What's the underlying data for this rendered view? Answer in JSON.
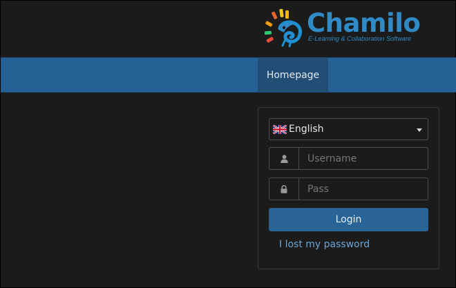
{
  "branding": {
    "name": "Chamilo",
    "tagline": "E-Learning & Collaboration Software",
    "colors": {
      "primary": "#2f8ac5",
      "rays": [
        "#e74c3c",
        "#f39c12",
        "#f1c40f",
        "#2ecc71",
        "#1e8fd0"
      ]
    }
  },
  "navbar": {
    "items": [
      {
        "label": "Homepage",
        "active": true
      }
    ],
    "colors": {
      "background": "#266195",
      "active": "#224d74"
    }
  },
  "login": {
    "language": {
      "selected": "English",
      "flag": "uk-flag-icon"
    },
    "username": {
      "placeholder": "Username",
      "value": "",
      "icon": "user-icon"
    },
    "password": {
      "placeholder": "Pass",
      "value": "",
      "icon": "lock-icon"
    },
    "submit_label": "Login",
    "lost_password_label": "I lost my password",
    "colors": {
      "button": "#2a6496",
      "link": "#6ba7d6"
    }
  }
}
